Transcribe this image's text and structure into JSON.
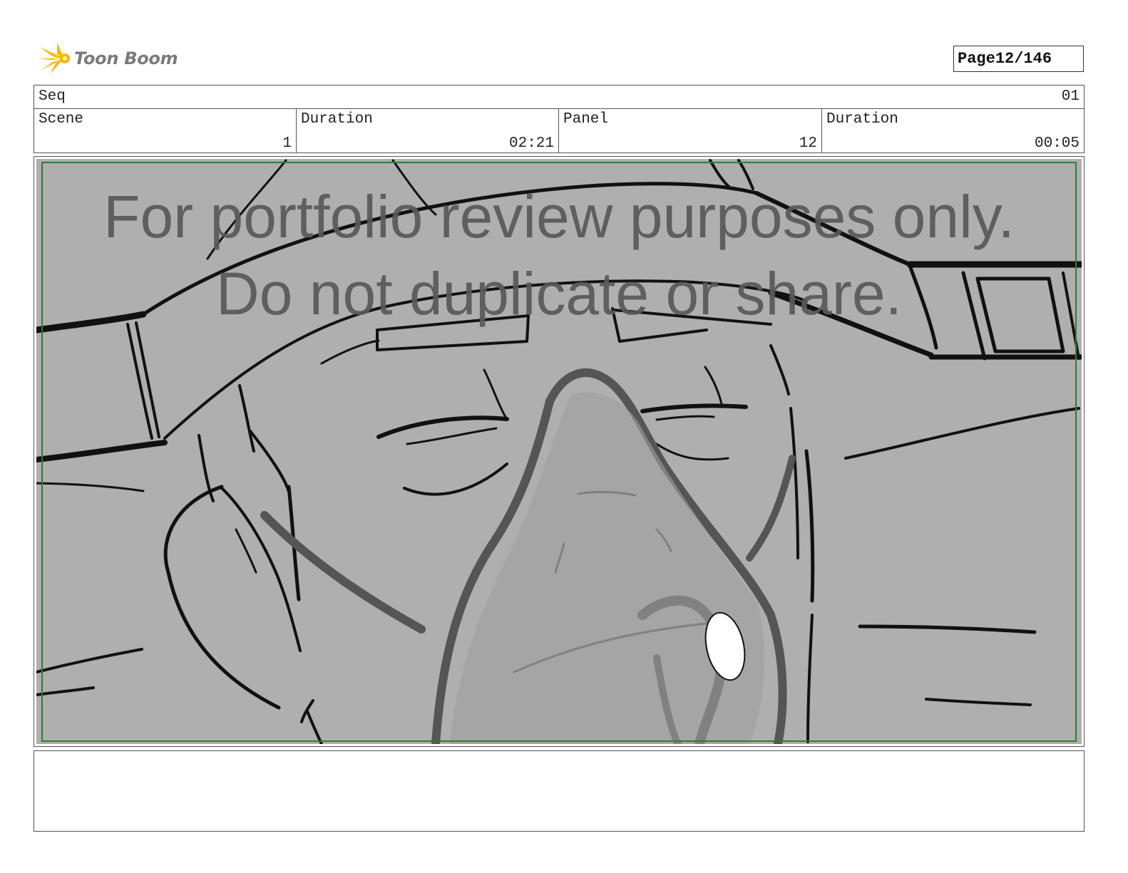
{
  "header": {
    "logo_text": "Toon Boom",
    "logo_icon": "starburst-icon",
    "page_label": "Page",
    "page_value": "12/146"
  },
  "meta": {
    "seq_label": "Seq",
    "seq_value": "01",
    "scene_label": "Scene",
    "scene_value": "1",
    "scene_duration_label": "Duration",
    "scene_duration_value": "02:21",
    "panel_label": "Panel",
    "panel_value": "12",
    "panel_duration_label": "Duration",
    "panel_duration_value": "00:05"
  },
  "panel": {
    "watermark_line1": "For portfolio review purposes only.",
    "watermark_line2": "Do not duplicate or share.",
    "background_color": "#afafaf",
    "safe_area_color": "#2e7d32"
  },
  "notes": {
    "text": ""
  }
}
